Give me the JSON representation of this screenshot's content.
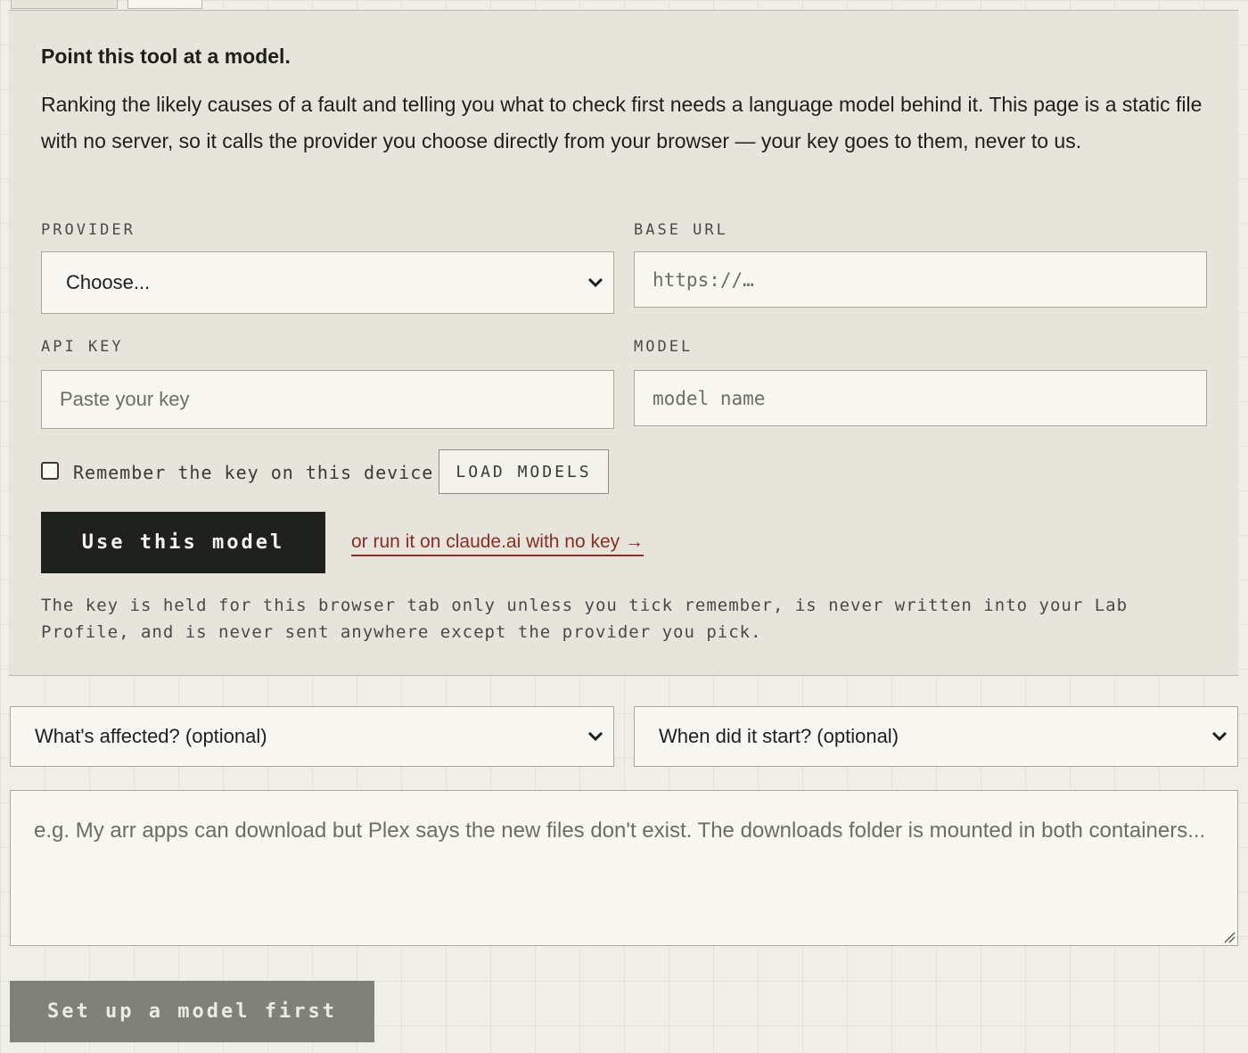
{
  "model_panel": {
    "title": "Point this tool at a model.",
    "description": "Ranking the likely causes of a fault and telling you what to check first needs a language model behind it. This page is a static file with no server, so it calls the provider you choose directly from your browser — your key goes to them, never to us.",
    "provider": {
      "label": "PROVIDER",
      "selected": "Choose..."
    },
    "base_url": {
      "label": "BASE URL",
      "placeholder": "https://…"
    },
    "api_key": {
      "label": "API KEY",
      "placeholder": "Paste your key"
    },
    "model": {
      "label": "MODEL",
      "placeholder": "model name"
    },
    "remember": {
      "label": "Remember the key on this device",
      "checked": false
    },
    "load_models_label": "LOAD MODELS",
    "use_model_label": "Use this model",
    "claude_link": "or run it on claude.ai with no key →",
    "note": "The key is held for this browser tab only unless you tick remember, is never written into your Lab Profile, and is never sent anywhere except the provider you pick."
  },
  "affected_select": {
    "selected": "What's affected? (optional)"
  },
  "started_select": {
    "selected": "When did it start? (optional)"
  },
  "problem_textarea": {
    "placeholder": "e.g. My arr apps can download but Plex says the new files don't exist. The downloads folder is mounted in both containers..."
  },
  "submit_label": "Set up a model first",
  "icons": {
    "select": "chevron-down-icon",
    "textarea": "resize-grip-icon"
  },
  "colors": {
    "accent_link": "#8a2d22",
    "primary_button": "#1f211d",
    "disabled_button": "#80817b",
    "panel": "#e7e5db"
  }
}
